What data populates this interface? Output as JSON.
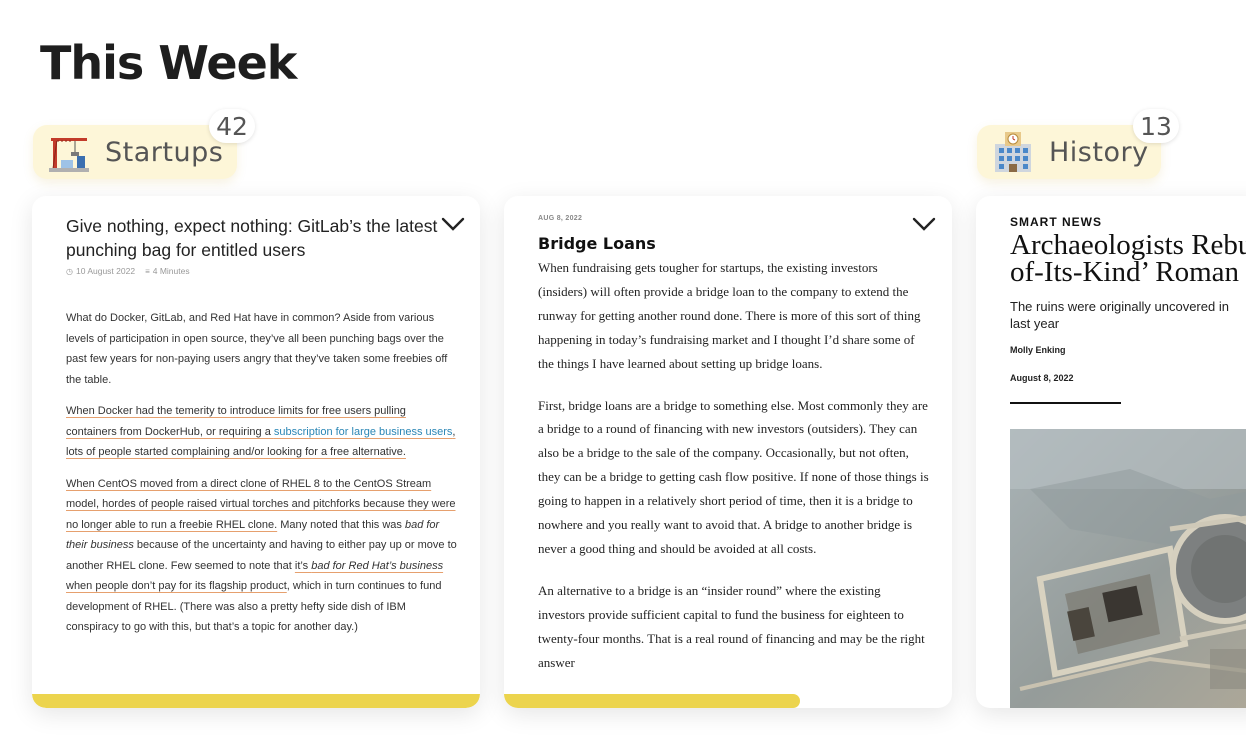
{
  "page": {
    "title": "This Week"
  },
  "categories": [
    {
      "label": "Startups",
      "count": "42",
      "icon": "construction-crane-icon"
    },
    {
      "label": "History",
      "count": "13",
      "icon": "building-clock-icon"
    }
  ],
  "cards": {
    "gitlab": {
      "title": "Give nothing, expect nothing: GitLab’s the latest punching bag for entitled users",
      "date": "10 August 2022",
      "read_time": "4 Minutes",
      "p1": "What do Docker, GitLab, and Red Hat have in common? Aside from various levels of participation in open source, they’ve all been punching bags over the past few years for non-paying users angry that they’ve taken some freebies off the table.",
      "p2_a": "When Docker had the temerity to introduce limits for free users pulling containers from DockerHub, or requiring a ",
      "p2_link": "subscription for large business users",
      "p2_b": ", lots of people started complaining and/or looking for a free alternative.",
      "p3_a": "When CentOS moved from a direct clone of RHEL 8 to the CentOS Stream model, hordes of people raised virtual torches and pitchforks because they were no longer able to run a freebie RHEL clone.",
      "p3_b": " Many noted that this was ",
      "p3_em1": "bad for their business",
      "p3_c": " because of the uncertainty and having to either pay up or move to another RHEL clone. Few seemed to note that ",
      "p3_d": "it’s ",
      "p3_em2": "bad for Red Hat’s business",
      "p3_e": " when people don’t pay for its flagship product",
      "p3_f": ", which in turn continues to fund development of RHEL. (There was also a pretty hefty side dish of IBM conspiracy to go with this, but that’s a topic for another day.)",
      "progress": 1.0
    },
    "bridge": {
      "date": "AUG 8, 2022",
      "title": "Bridge Loans",
      "p1": "When fundraising gets tougher for startups, the existing investors (insiders) will often provide a bridge loan to the company to extend the runway for getting another round done. There is more of this sort of thing happening in today’s fundraising market and I thought I’d share some of the things I have learned about setting up bridge loans.",
      "p2": "First, bridge loans are a bridge to something else. Most commonly they are a bridge to a round of financing with new investors (outsiders). They can also be a bridge to the sale of the company. Occasionally, but not often, they can be a bridge to getting cash flow positive. If none of those things is going to happen in a relatively short period of time, then it is a bridge to nowhere and you really want to avoid that. A bridge to another bridge is never a good thing and should be avoided at all costs.",
      "p3": "An alternative to a bridge is an “insider round” where the existing investors provide sufficient capital to fund the business for eighteen to twenty-four months. That is a real round of financing and may be the right answer",
      "progress": 0.66
    },
    "archaeology": {
      "kicker": "SMART NEWS",
      "title_line1": "Archaeologists Rebu",
      "title_line2": "of-Its-Kind’ Roman",
      "dek_line1": "The ruins were originally uncovered in",
      "dek_line2": "last year",
      "author": "Molly Enking",
      "date": "August 8, 2022"
    }
  },
  "colors": {
    "accent": "#ecd44d",
    "chip_bg": "#fdf6d8",
    "link": "#2a86b5"
  }
}
